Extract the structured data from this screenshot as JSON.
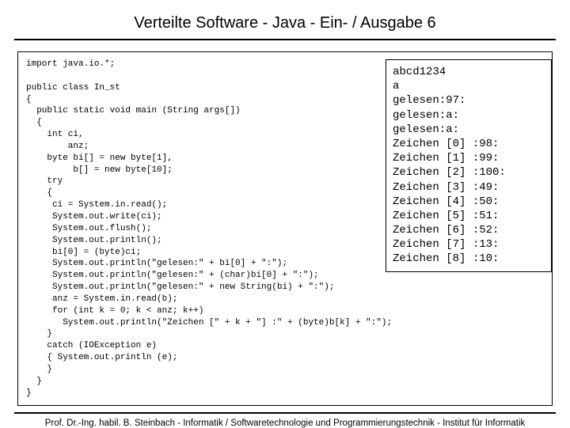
{
  "title": "Verteilte Software - Java - Ein- / Ausgabe 6",
  "code": "import java.io.*;\n\npublic class In_st\n{\n  public static void main (String args[])\n  {\n    int ci,\n        anz;\n    byte bi[] = new byte[1],\n         b[] = new byte[10];\n    try\n    {\n     ci = System.in.read();\n     System.out.write(ci);\n     System.out.flush();\n     System.out.println();\n     bi[0] = (byte)ci;\n     System.out.println(\"gelesen:\" + bi[0] + \":\");\n     System.out.println(\"gelesen:\" + (char)bi[0] + \":\");\n     System.out.println(\"gelesen:\" + new String(bi) + \":\");\n     anz = System.in.read(b);\n     for (int k = 0; k < anz; k++)\n       System.out.println(\"Zeichen [\" + k + \"] :\" + (byte)b[k] + \":\");\n    }\n    catch (IOException e)\n    { System.out.println (e);\n    }\n  }\n}",
  "output": "abcd1234\na\ngelesen:97:\ngelesen:a:\ngelesen:a:\nZeichen [0] :98:\nZeichen [1] :99:\nZeichen [2] :100:\nZeichen [3] :49:\nZeichen [4] :50:\nZeichen [5] :51:\nZeichen [6] :52:\nZeichen [7] :13:\nZeichen [8] :10:",
  "footer": "Prof. Dr.-Ing. habil. B. Steinbach - Informatik / Softwaretechnologie und Programmierungstechnik - Institut für Informatik"
}
